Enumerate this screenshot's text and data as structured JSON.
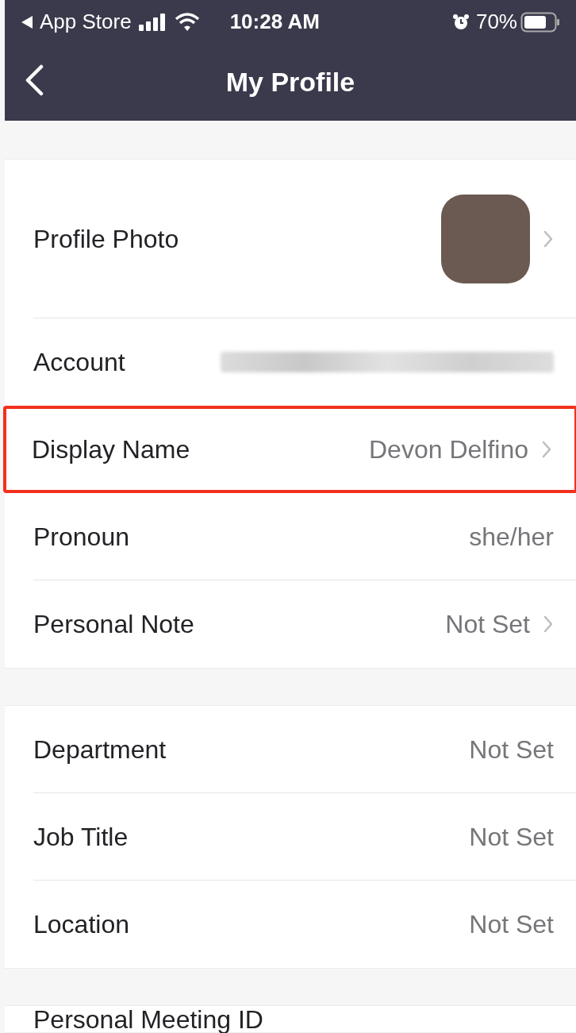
{
  "status_bar": {
    "back_app": "App Store",
    "time": "10:28 AM",
    "battery": "70%"
  },
  "nav": {
    "title": "My Profile"
  },
  "sections": [
    {
      "rows": [
        {
          "kind": "photo",
          "label": "Profile Photo",
          "chevron": true,
          "highlighted": false
        },
        {
          "kind": "blurred",
          "label": "Account",
          "chevron": false,
          "highlighted": false
        },
        {
          "kind": "text",
          "label": "Display Name",
          "value": "Devon Delfino",
          "chevron": true,
          "highlighted": true
        },
        {
          "kind": "text",
          "label": "Pronoun",
          "value": "she/her",
          "chevron": false,
          "highlighted": false
        },
        {
          "kind": "text",
          "label": "Personal Note",
          "value": "Not Set",
          "chevron": true,
          "highlighted": false
        }
      ]
    },
    {
      "rows": [
        {
          "kind": "text",
          "label": "Department",
          "value": "Not Set",
          "chevron": false,
          "highlighted": false
        },
        {
          "kind": "text",
          "label": "Job Title",
          "value": "Not Set",
          "chevron": false,
          "highlighted": false
        },
        {
          "kind": "text",
          "label": "Location",
          "value": "Not Set",
          "chevron": false,
          "highlighted": false
        }
      ]
    },
    {
      "rows": [
        {
          "kind": "label",
          "label": "Personal Meeting ID",
          "chevron": false,
          "highlighted": false
        }
      ]
    }
  ]
}
